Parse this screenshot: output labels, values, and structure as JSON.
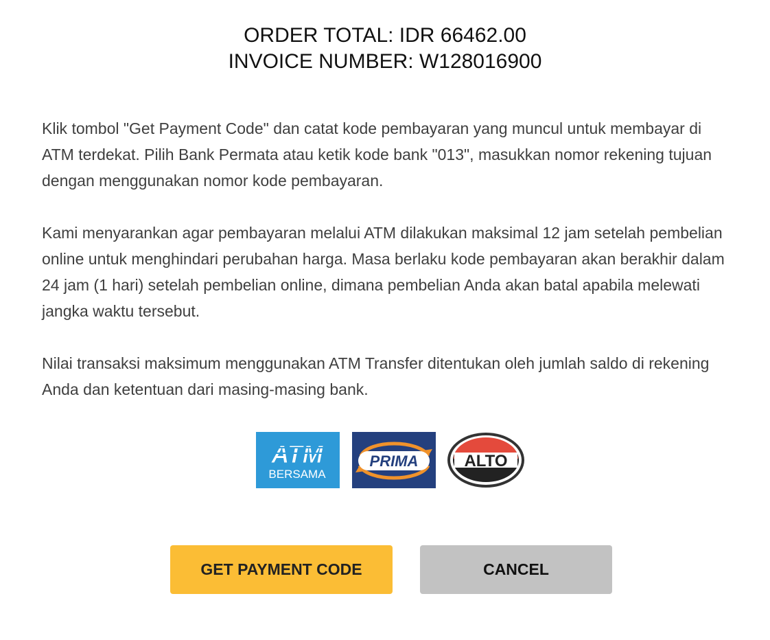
{
  "header": {
    "order_total": "ORDER TOTAL: IDR 66462.00",
    "invoice_number": "INVOICE NUMBER: W128016900"
  },
  "instructions": [
    "Klik tombol \"Get Payment Code\" dan catat kode pembayaran yang muncul untuk membayar di ATM terdekat. Pilih Bank Permata atau ketik kode bank \"013\", masukkan nomor rekening tujuan dengan menggunakan nomor kode pembayaran.",
    "Kami menyarankan agar pembayaran melalui ATM dilakukan maksimal 12 jam setelah pembelian online untuk menghindari perubahan harga. Masa berlaku kode pembayaran akan berakhir dalam 24 jam (1 hari) setelah pembelian online, dimana pembelian Anda akan batal apabila melewati jangka waktu tersebut.",
    "Nilai transaksi maksimum menggunakan ATM Transfer ditentukan oleh jumlah saldo di rekening Anda dan ketentuan dari masing-masing bank."
  ],
  "logos": {
    "atm_bersama": {
      "line1": "ATM",
      "line2": "BERSAMA",
      "color": "#2e9ad8"
    },
    "prima": {
      "text": "PRIMA",
      "color": "#24407e",
      "accent": "#f0922b"
    },
    "alto": {
      "text": "ALTO",
      "color": "#e44a3c"
    }
  },
  "buttons": {
    "get_payment_code": "GET PAYMENT CODE",
    "cancel": "CANCEL"
  },
  "colors": {
    "primary_button": "#fbbd35",
    "secondary_button": "#c2c2c2"
  }
}
